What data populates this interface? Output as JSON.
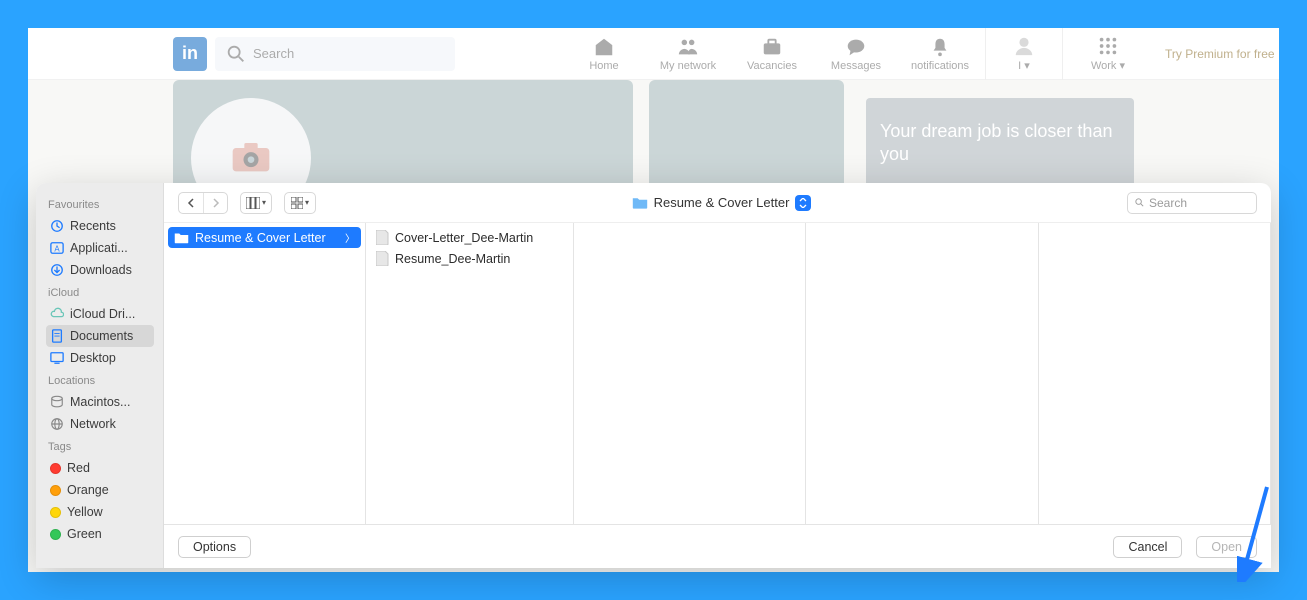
{
  "linkedin": {
    "logo_text": "in",
    "search_placeholder": "Search",
    "nav": [
      {
        "icon": "home",
        "label": "Home"
      },
      {
        "icon": "people",
        "label": "My network"
      },
      {
        "icon": "briefcase",
        "label": "Vacancies"
      },
      {
        "icon": "chat",
        "label": "Messages"
      },
      {
        "icon": "bell",
        "label": "notifications"
      },
      {
        "icon": "avatar",
        "label": "I ▾"
      },
      {
        "icon": "apps",
        "label": "Work ▾"
      }
    ],
    "premium_label": "Try Premium for free",
    "promo_text": "Your dream job is closer than you"
  },
  "dialog": {
    "sidebar": {
      "sections": [
        {
          "title": "Favourites",
          "items": [
            {
              "icon": "clock",
              "label": "Recents",
              "selected": false
            },
            {
              "icon": "a-window",
              "label": "Applicati...",
              "selected": false
            },
            {
              "icon": "download",
              "label": "Downloads",
              "selected": false
            }
          ]
        },
        {
          "title": "iCloud",
          "items": [
            {
              "icon": "cloud",
              "label": "iCloud Dri...",
              "selected": false
            },
            {
              "icon": "doc",
              "label": "Documents",
              "selected": true
            },
            {
              "icon": "desktop",
              "label": "Desktop",
              "selected": false
            }
          ]
        },
        {
          "title": "Locations",
          "items": [
            {
              "icon": "disk",
              "label": "Macintos...",
              "selected": false
            },
            {
              "icon": "globe",
              "label": "Network",
              "selected": false
            }
          ]
        },
        {
          "title": "Tags",
          "items": [
            {
              "icon": "dot",
              "color": "#ff3b30",
              "label": "Red"
            },
            {
              "icon": "dot",
              "color": "#ff9f0a",
              "label": "Orange"
            },
            {
              "icon": "dot",
              "color": "#ffd60a",
              "label": "Yellow"
            },
            {
              "icon": "dot",
              "color": "#34c759",
              "label": "Green"
            }
          ]
        }
      ]
    },
    "toolbar": {
      "current_folder": "Resume & Cover Letter",
      "search_placeholder": "Search"
    },
    "columns": [
      {
        "items": [
          {
            "icon": "folder",
            "label": "Resume & Cover Letter",
            "selected": true,
            "has_children": true
          }
        ]
      },
      {
        "items": [
          {
            "icon": "file",
            "label": "Cover-Letter_Dee-Martin",
            "selected": false
          },
          {
            "icon": "file",
            "label": "Resume_Dee-Martin",
            "selected": false
          }
        ]
      },
      {
        "items": []
      },
      {
        "items": []
      },
      {
        "items": []
      }
    ],
    "footer": {
      "options_label": "Options",
      "cancel_label": "Cancel",
      "open_label": "Open"
    }
  }
}
